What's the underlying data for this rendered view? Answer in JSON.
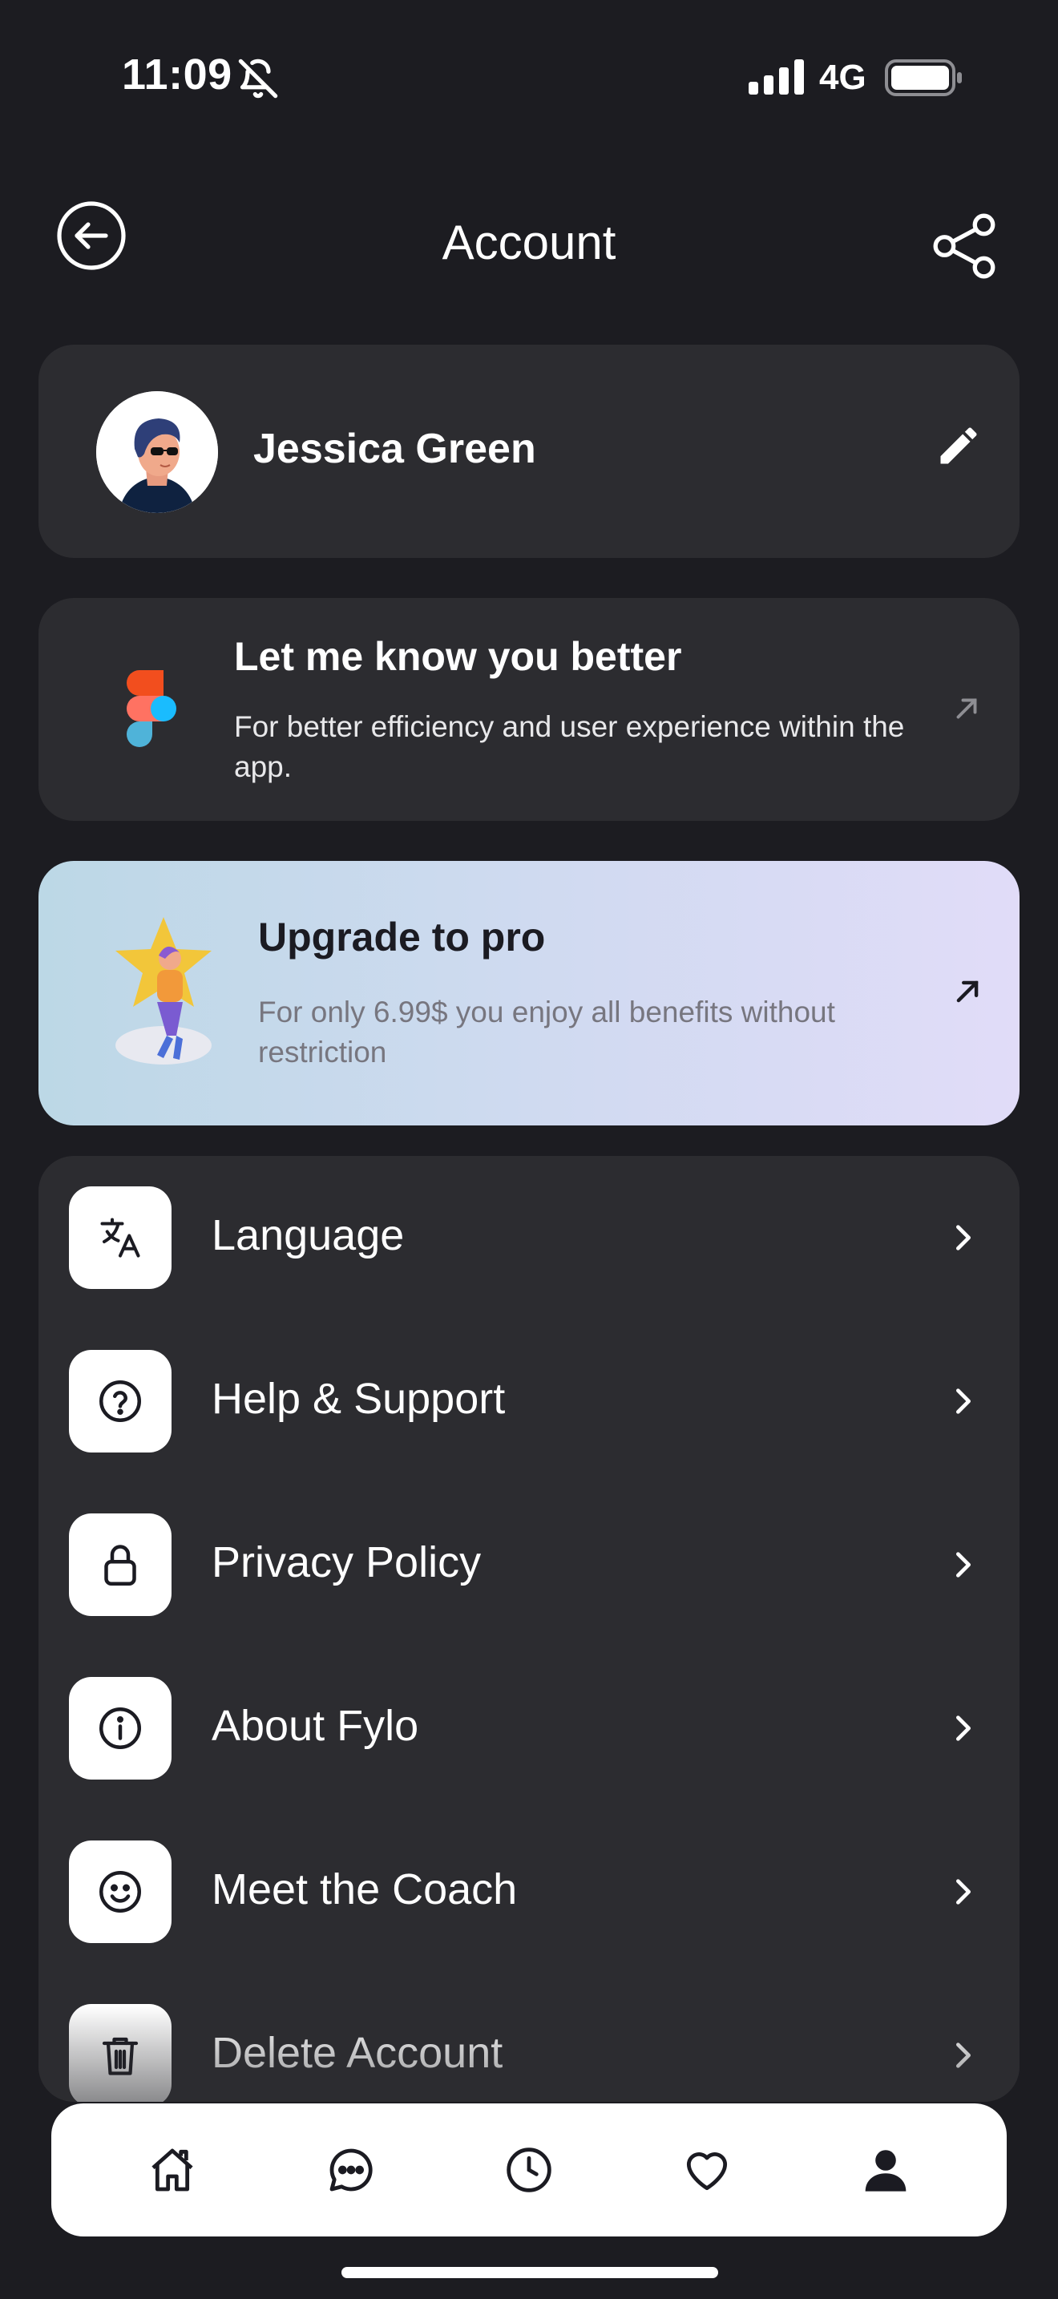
{
  "status_bar": {
    "time": "11:09",
    "network": "4G",
    "icons": [
      "bell-slash-icon",
      "signal-icon",
      "battery-icon"
    ]
  },
  "header": {
    "title": "Account",
    "back_icon": "back-arrow-circle-icon",
    "share_icon": "share-icon"
  },
  "profile": {
    "name": "Jessica Green",
    "edit_icon": "pencil-icon"
  },
  "know_you": {
    "title": "Let me know you better",
    "description": "For better efficiency and user experience within the app.",
    "icon": "figma-logo"
  },
  "upgrade": {
    "title": "Upgrade to pro",
    "description": "For only 6.99$ you enjoy all benefits without restriction"
  },
  "menu": {
    "items": [
      {
        "label": "Language",
        "icon": "translate-icon"
      },
      {
        "label": "Help & Support",
        "icon": "question-circle-icon"
      },
      {
        "label": "Privacy Policy",
        "icon": "lock-icon"
      },
      {
        "label": "About Fylo",
        "icon": "info-circle-icon"
      },
      {
        "label": "Meet the Coach",
        "icon": "smiley-icon"
      },
      {
        "label": "Delete Account",
        "icon": "trash-icon"
      }
    ]
  },
  "tabbar": {
    "tabs": [
      "home-icon",
      "chat-icon",
      "clock-icon",
      "heart-icon",
      "profile-icon"
    ],
    "active": "profile-icon"
  },
  "colors": {
    "background": "#1c1c21",
    "card": "#2c2c30",
    "pro_gradient_start": "#bcd8e6",
    "pro_gradient_end": "#e1dcf8"
  }
}
